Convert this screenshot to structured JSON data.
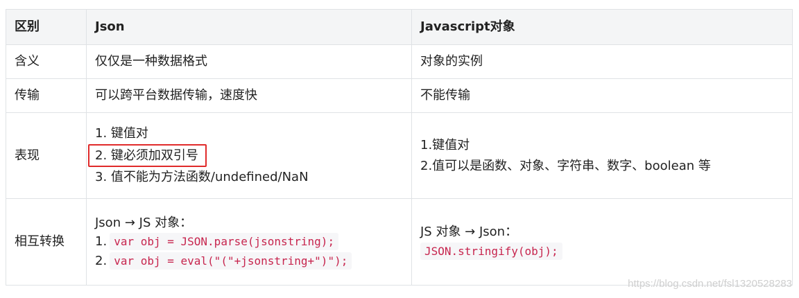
{
  "table": {
    "headers": [
      "区别",
      "Json",
      "Javascript对象"
    ],
    "rows": {
      "meaning": {
        "label": "含义",
        "json": "仅仅是一种数据格式",
        "js": "对象的实例"
      },
      "transfer": {
        "label": "传输",
        "json": "可以跨平台数据传输，速度快",
        "js": "不能传输"
      },
      "display": {
        "label": "表现",
        "json": [
          "1. 键值对",
          "2. 键必须加双引号",
          "3. 值不能为方法函数/undefined/NaN"
        ],
        "js": [
          "1.键值对",
          "2.值可以是函数、对象、字符串、数字、boolean 等"
        ]
      },
      "convert": {
        "label": "相互转换",
        "json_title": "Json → JS 对象：",
        "json_items": [
          {
            "num": "1.",
            "code": "var obj = JSON.parse(jsonstring);"
          },
          {
            "num": "2.",
            "code": "var obj = eval(\"(\"+jsonstring+\")\");"
          }
        ],
        "js_title": "JS 对象 → Json：",
        "js_code": "JSON.stringify(obj);"
      }
    }
  },
  "watermark": "https://blog.csdn.net/fsl1320528283"
}
